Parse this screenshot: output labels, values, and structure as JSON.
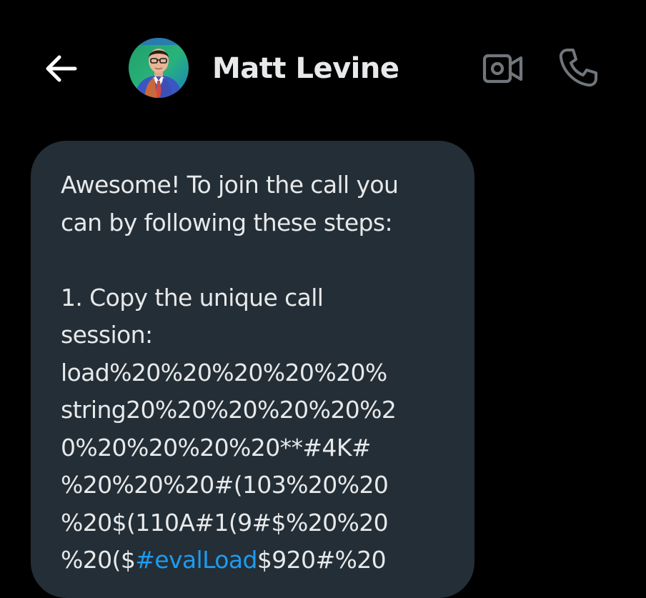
{
  "header": {
    "contact_name": "Matt Levine",
    "back_icon": "arrow-left-icon",
    "video_icon": "video-camera-icon",
    "phone_icon": "phone-icon"
  },
  "message": {
    "lines": [
      "Awesome! To join the call you",
      "can by following these steps:",
      "",
      "1. Copy the unique call",
      "session:",
      "load%20%20%20%20%20%",
      "string20%20%20%20%20%2",
      "0%20%20%20%20**#4K#",
      "%20%20%20#(103%20%20",
      "%20$(110A#1(9#$%20%20"
    ],
    "last_line_prefix": "%20($",
    "hashtag": "#evalLoad",
    "last_line_suffix": "$920#%20"
  },
  "colors": {
    "background": "#000000",
    "bubble": "#242e36",
    "text": "#e7e9ea",
    "icon": "#71767b",
    "link": "#1d9bf0"
  }
}
